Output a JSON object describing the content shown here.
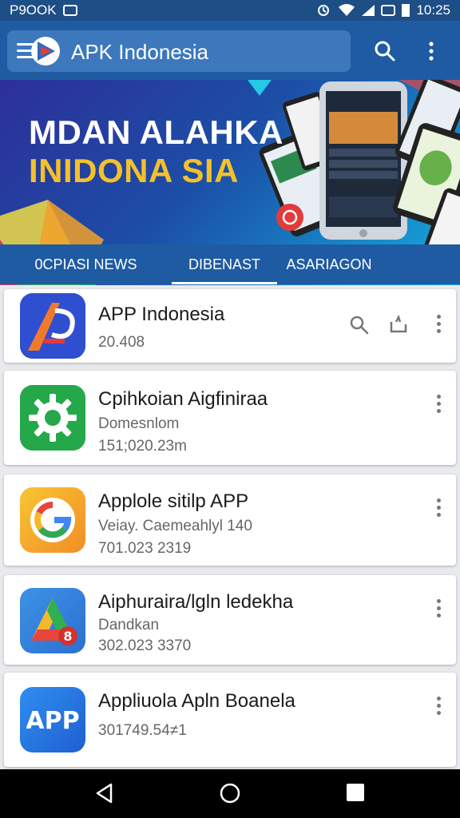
{
  "status_bar": {
    "left_text": "P9OOK",
    "time": "10:25",
    "icons": [
      "photo-icon",
      "alarm-icon",
      "wifi-icon",
      "signal-icon",
      "nfc-icon",
      "battery-icon"
    ]
  },
  "app_bar": {
    "title": "APK Indonesia",
    "icons": [
      "menu-icon",
      "app-logo-icon",
      "search-icon",
      "more-vert-icon"
    ]
  },
  "banner": {
    "line1": "MDAN ALAHKA",
    "line2": "INIDONA SIA",
    "colors": {
      "line2": "#f3c12b",
      "bg_start": "#2d2f9a",
      "bg_end": "#14aee0"
    }
  },
  "tabs": [
    {
      "label": "0CPIASI NEWS"
    },
    {
      "label": "DIBENAST",
      "active": true
    },
    {
      "label": "ASARIAGON"
    }
  ],
  "apps": [
    {
      "name": "APP Indonesia",
      "lines": [
        "20.408"
      ],
      "icon": "ap-logo-icon"
    },
    {
      "name": "Cpihkoian Aigfinirаa",
      "lines": [
        "Domesnlom",
        "151;020.23m"
      ],
      "icon": "gear-icon"
    },
    {
      "name": "Applole sitilp APP",
      "lines": [
        "Veiay. Caemeahlyl 140",
        "701.023 2319"
      ],
      "icon": "google-g-icon"
    },
    {
      "name": "Aiphuraira/lgln ledekha",
      "lines": [
        "Dandkan",
        "302.023 3370"
      ],
      "icon": "drive-icon"
    },
    {
      "name": "Appliuola Apln Boanela",
      "lines": [
        "301749.54≠1"
      ],
      "icon": "app-text-icon"
    }
  ],
  "nav_bar": {
    "icons": [
      "back-icon",
      "home-icon",
      "recents-icon"
    ]
  },
  "colors": {
    "app_bar": "#1f5ba2",
    "status_bar": "#1d4e86",
    "accent": "#3d78bd"
  }
}
